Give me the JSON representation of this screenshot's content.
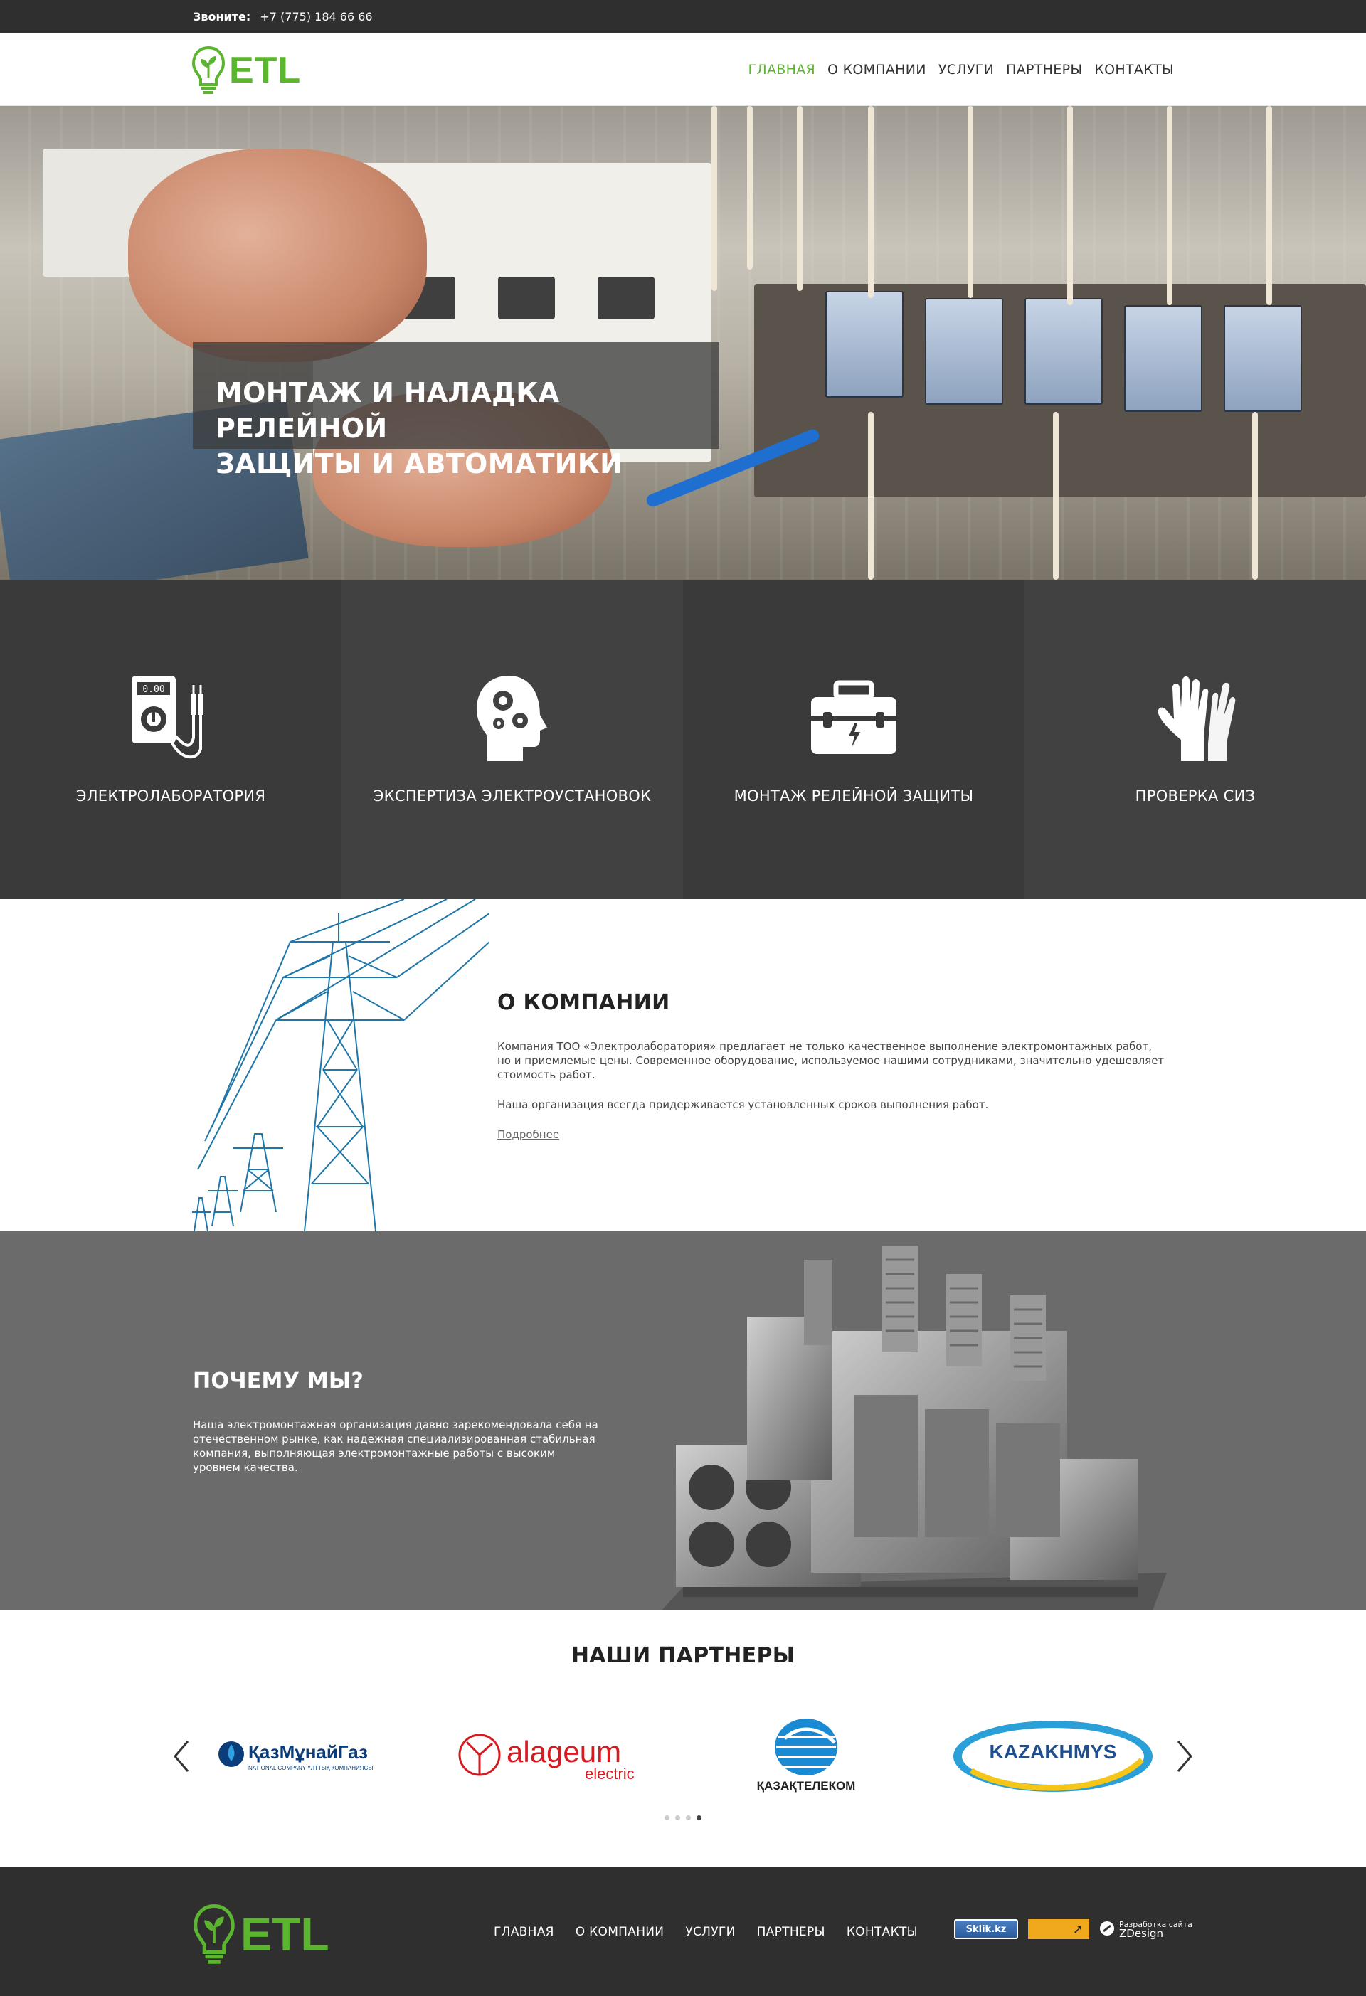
{
  "topbar": {
    "phone_label": "Звоните:",
    "phone_number": "+7 (775) 184 66 66"
  },
  "header": {
    "logo_text": "ETL",
    "nav": [
      {
        "label": "ГЛАВНАЯ",
        "active": true
      },
      {
        "label": "О КОМПАНИИ",
        "active": false
      },
      {
        "label": "УСЛУГИ",
        "active": false
      },
      {
        "label": "ПАРТНЕРЫ",
        "active": false
      },
      {
        "label": "КОНТАКТЫ",
        "active": false
      }
    ]
  },
  "hero": {
    "title_line1": "МОНТАЖ И НАЛАДКА РЕЛЕЙНОЙ",
    "title_line2": "ЗАЩИТЫ И АВТОМАТИКИ"
  },
  "services": [
    {
      "label": "ЭЛЕКТРОЛАБОРАТОРИЯ",
      "icon": "multimeter-icon"
    },
    {
      "label": "ЭКСПЕРТИЗА ЭЛЕКТРОУСТАНОВОК",
      "icon": "head-gears-icon"
    },
    {
      "label": "МОНТАЖ РЕЛЕЙНОЙ ЗАЩИТЫ",
      "icon": "toolbox-icon"
    },
    {
      "label": "ПРОВЕРКА СИЗ",
      "icon": "gloves-icon"
    }
  ],
  "about": {
    "title": "О КОМПАНИИ",
    "paragraph1": "Компания ТОО «Электролаборатория» предлагает не только качественное выполнение электромонтажных работ, но и приемлемые цены. Современное оборудование, используемое нашими сотрудниками, значительно удешевляет стоимость работ.",
    "paragraph2": "Наша организация всегда придерживается установленных сроков выполнения работ.",
    "more_link": "Подробнее"
  },
  "why": {
    "title": "ПОЧЕМУ МЫ?",
    "text": "Наша электромонтажная организация давно зарекомендовала себя на отечественном рынке, как надежная специализированная стабильная компания, выполняющая электромонтажные работы с высоким уровнем качества."
  },
  "partners": {
    "title": "НАШИ ПАРТНЕРЫ",
    "logos": [
      {
        "name": "ҚазМұнайГаз",
        "sub": "NATIONAL COMPANY ҰЛТТЫҚ КОМПАНИЯСЫ"
      },
      {
        "name": "alageum",
        "sub": "electric"
      },
      {
        "name": "ҚАЗАҚТЕЛЕКОМ"
      },
      {
        "name": "KAZAKHMYS"
      }
    ],
    "slides_total": 4,
    "slide_active": 4
  },
  "footer": {
    "logo_text": "ETL",
    "nav": [
      "ГЛАВНАЯ",
      "О КОМПАНИИ",
      "УСЛУГИ",
      "ПАРТНЕРЫ",
      "КОНТАКТЫ"
    ],
    "badge_kz": "Sklik.kz",
    "dev_line1": "Разработка сайта",
    "dev_line2": "ZDesign"
  },
  "colors": {
    "accent": "#5bb52e",
    "dark": "#2f2f2f",
    "services_bg": "#3a3a3a",
    "why_bg": "#6b6b6b"
  }
}
